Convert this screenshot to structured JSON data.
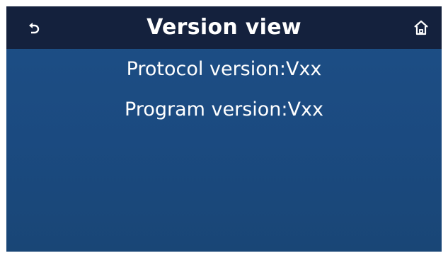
{
  "header": {
    "title": "Version view",
    "back_icon": "back-arrow-icon",
    "home_icon": "home-icon"
  },
  "info": {
    "protocol_version": "Protocol version:Vxx",
    "program_version": "Program version:Vxx"
  },
  "colors": {
    "header_bg": "#14213d",
    "screen_bg": "#1d4f86",
    "text": "#ffffff"
  }
}
